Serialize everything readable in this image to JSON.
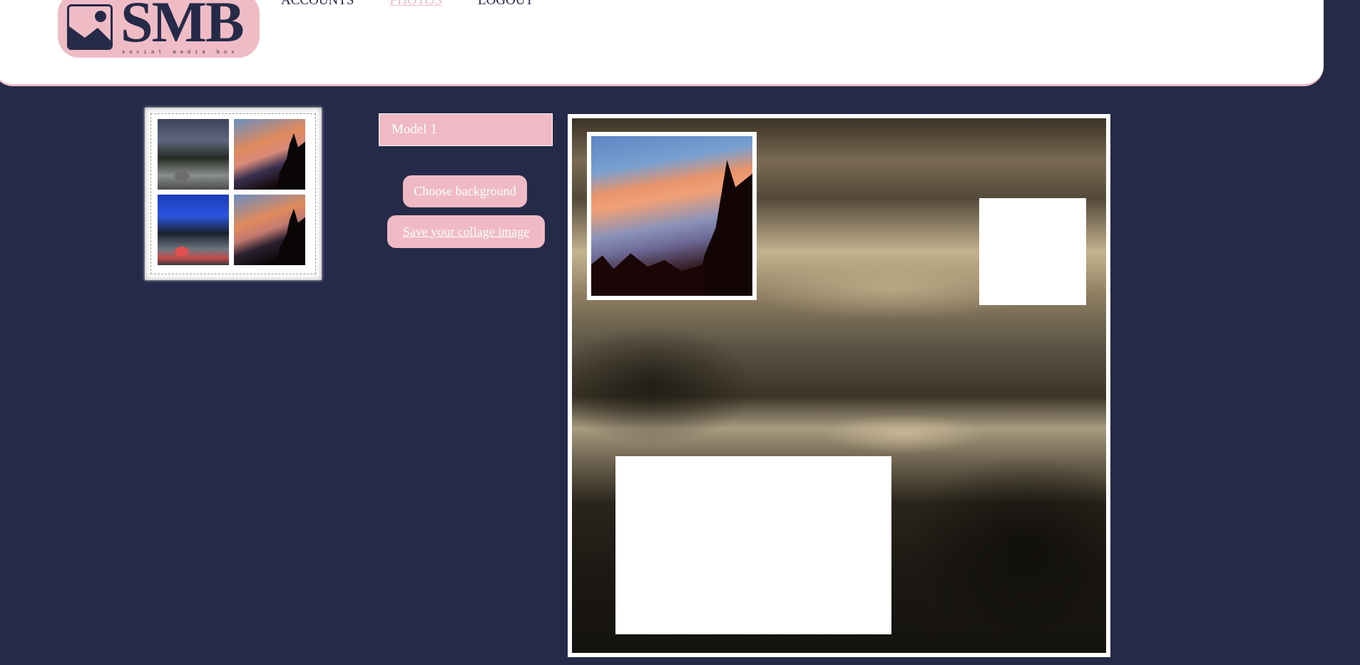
{
  "header": {
    "logo": {
      "text": "SMB",
      "tagline": "social media box"
    },
    "nav": [
      {
        "label": "ACCOUNTS",
        "active": false
      },
      {
        "label": "PHOTOS",
        "active": true
      },
      {
        "label": "LOGOUT",
        "active": false
      }
    ]
  },
  "controls": {
    "model_value": "Model 1",
    "choose_background_label": "Choose background",
    "save_label": "Save your collage image"
  },
  "colors": {
    "background": "#252a48",
    "accent_pink": "#efbac5",
    "white": "#ffffff"
  },
  "thumbnails": [
    {
      "name": "road-landscape"
    },
    {
      "name": "sunset-trees"
    },
    {
      "name": "blue-sky-road"
    },
    {
      "name": "sunset-trees"
    }
  ],
  "canvas": {
    "background": "sepia-landscape",
    "placed_photo": "sunset-trees",
    "empty_slots": 2
  }
}
